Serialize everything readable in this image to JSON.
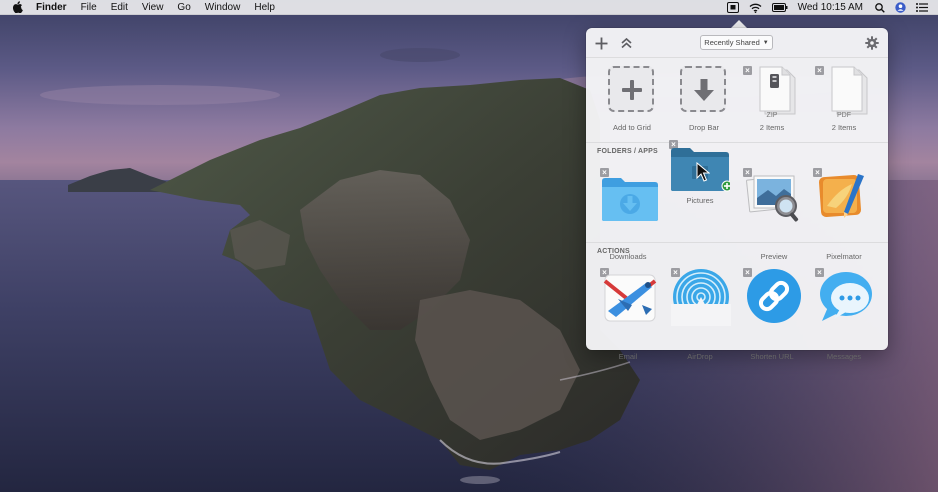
{
  "menubar": {
    "apple_icon": "apple-icon",
    "app_name": "Finder",
    "menus": [
      "File",
      "Edit",
      "View",
      "Go",
      "Window",
      "Help"
    ],
    "clock": "Wed 10:15 AM",
    "status_icons": [
      "dropzone-icon",
      "wifi-icon",
      "battery-icon",
      "search-icon",
      "user-icon",
      "list-icon"
    ]
  },
  "popover": {
    "toolbar": {
      "add_icon": "plus-icon",
      "collapse_icon": "chevron-double-up-icon",
      "dropdown_value": "Recently Shared",
      "settings_icon": "gear-icon"
    },
    "top_row": [
      {
        "label": "Add to Grid",
        "icon": "plus-icon"
      },
      {
        "label": "Drop Bar",
        "icon": "arrow-down-icon"
      },
      {
        "label": "2 Items",
        "badge": "ZIP",
        "icon": "zip-file-icon"
      },
      {
        "label": "2 Items",
        "badge": "PDF",
        "icon": "pdf-file-icon"
      }
    ],
    "folders_section": {
      "title": "FOLDERS / APPS",
      "items": [
        {
          "label": "Downloads",
          "icon": "downloads-folder-icon"
        },
        {
          "label": "Pictures",
          "icon": "pictures-folder-icon"
        },
        {
          "label": "Preview",
          "icon": "preview-app-icon"
        },
        {
          "label": "Pixelmator",
          "icon": "pixelmator-app-icon"
        }
      ]
    },
    "actions_section": {
      "title": "ACTIONS",
      "items": [
        {
          "label": "Email",
          "icon": "email-icon"
        },
        {
          "label": "AirDrop",
          "icon": "airdrop-icon"
        },
        {
          "label": "Shorten URL",
          "icon": "link-icon"
        },
        {
          "label": "Messages",
          "icon": "messages-icon"
        }
      ]
    },
    "close_glyph": "×"
  },
  "colors": {
    "accent_blue": "#2d9be6",
    "folder_blue": "#5bb4ea",
    "panel_bg": "#f4f4f6"
  }
}
